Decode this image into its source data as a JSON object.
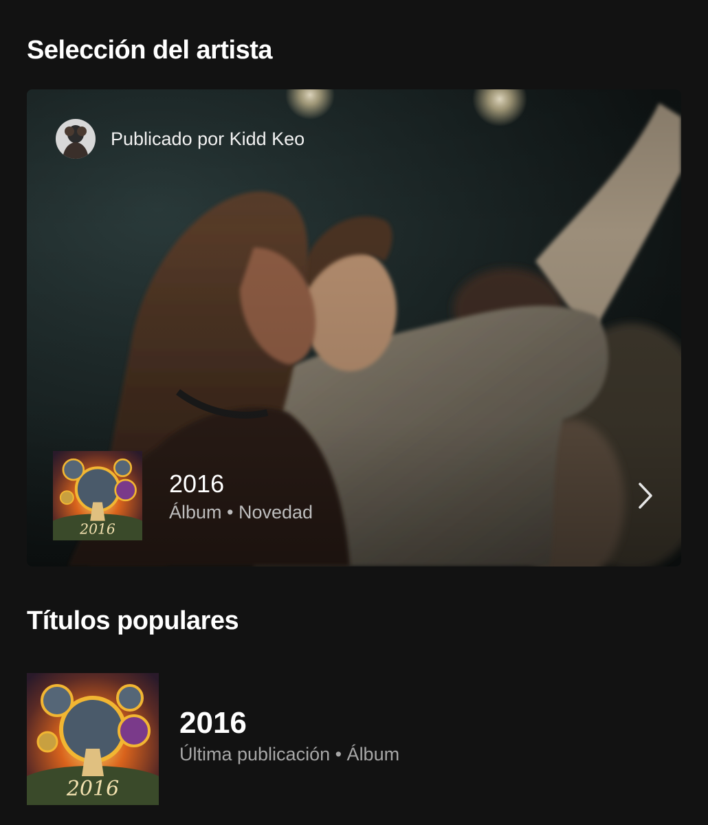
{
  "artist_pick": {
    "section_title": "Selección del artista",
    "published_by": "Publicado por Kidd Keo",
    "release": {
      "title": "2016",
      "subtitle": "Álbum • Novedad",
      "cover_text": "2016"
    },
    "chevron_icon": "chevron-right-icon"
  },
  "popular": {
    "section_title": "Títulos populares",
    "items": [
      {
        "title": "2016",
        "subtitle": "Última publicación • Álbum",
        "cover_text": "2016"
      }
    ]
  },
  "colors": {
    "background": "#121212",
    "text_primary": "#ffffff",
    "text_secondary": "#a7a7a7",
    "cover_gold": "#f2b632",
    "cover_orange": "#d9631c"
  }
}
